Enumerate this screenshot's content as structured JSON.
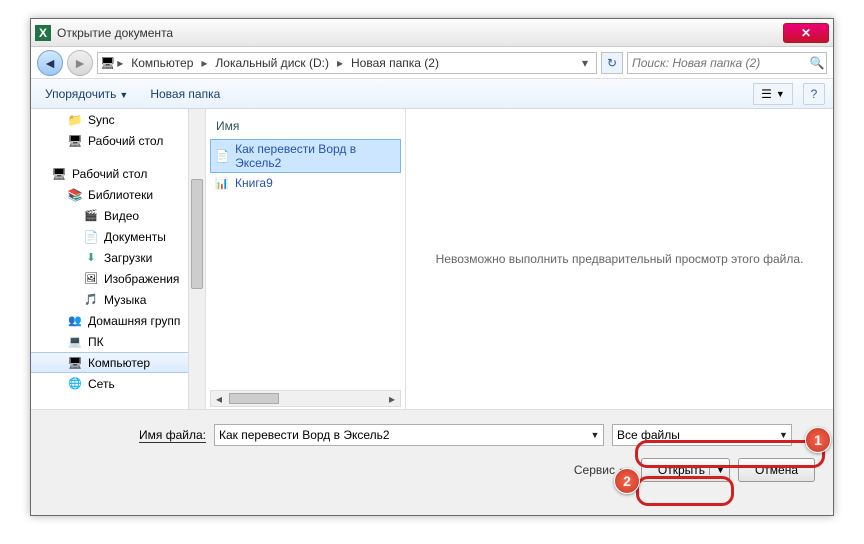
{
  "window": {
    "title": "Открытие документа"
  },
  "nav": {
    "segments": [
      "Компьютер",
      "Локальный диск (D:)",
      "Новая папка (2)"
    ],
    "search_placeholder": "Поиск: Новая папка (2)"
  },
  "toolbar": {
    "organize": "Упорядочить",
    "newfolder": "Новая папка"
  },
  "tree": {
    "items": [
      {
        "label": "Sync",
        "cls": "folder",
        "lvl": 1
      },
      {
        "label": "Рабочий стол",
        "cls": "desktop",
        "lvl": 1
      },
      {
        "label": "",
        "cls": "",
        "lvl": 0,
        "blank": true
      },
      {
        "label": "Рабочий стол",
        "cls": "desktop",
        "lvl": 0
      },
      {
        "label": "Библиотеки",
        "cls": "lib",
        "lvl": 1
      },
      {
        "label": "Видео",
        "cls": "video",
        "lvl": 2
      },
      {
        "label": "Документы",
        "cls": "doc",
        "lvl": 2
      },
      {
        "label": "Загрузки",
        "cls": "down",
        "lvl": 2
      },
      {
        "label": "Изображения",
        "cls": "img",
        "lvl": 2
      },
      {
        "label": "Музыка",
        "cls": "music",
        "lvl": 2
      },
      {
        "label": "Домашняя групп",
        "cls": "home",
        "lvl": 1
      },
      {
        "label": "ПК",
        "cls": "pc",
        "lvl": 1
      },
      {
        "label": "Компьютер",
        "cls": "comp",
        "lvl": 1,
        "selected": true
      },
      {
        "label": "Сеть",
        "cls": "net",
        "lvl": 1
      }
    ]
  },
  "filelist": {
    "header": "Имя",
    "files": [
      {
        "name": "Как перевести Ворд в Эксель2",
        "cls": "txt",
        "selected": true
      },
      {
        "name": "Книга9",
        "cls": "xls"
      }
    ]
  },
  "preview": {
    "msg": "Невозможно выполнить предварительный просмотр этого файла."
  },
  "bottom": {
    "filename_label": "Имя файла:",
    "filename_value": "Как перевести Ворд в Эксель2",
    "filter_value": "Все файлы",
    "service": "Сервис",
    "open": "Открыть",
    "cancel": "Отмена"
  },
  "badges": {
    "one": "1",
    "two": "2"
  }
}
